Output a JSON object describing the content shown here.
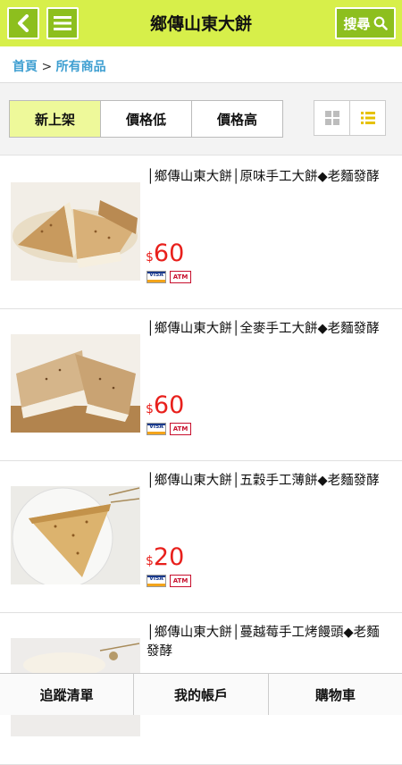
{
  "header": {
    "title": "鄉傳山東大餅",
    "search_label": "搜尋",
    "back_icon": "chevron-left-icon",
    "menu_icon": "hamburger-menu-icon",
    "accent_color": "#d7ef4a",
    "button_color": "#8dbf1e"
  },
  "breadcrumb": {
    "home": "首頁",
    "separator": ">",
    "current": "所有商品"
  },
  "sort": {
    "tabs": [
      "新上架",
      "價格低",
      "價格高"
    ],
    "active_index": 0
  },
  "view_toggle": {
    "grid_icon": "grid-view-icon",
    "list_icon": "list-view-icon",
    "active": "list"
  },
  "products": [
    {
      "name": "│鄉傳山東大餅│原味手工大餅◆老麵發酵",
      "currency": "$",
      "price": "60",
      "payments": [
        "VISA",
        "ATM"
      ]
    },
    {
      "name": "│鄉傳山東大餅│全麥手工大餅◆老麵發酵",
      "currency": "$",
      "price": "60",
      "payments": [
        "VISA",
        "ATM"
      ]
    },
    {
      "name": "│鄉傳山東大餅│五穀手工薄餅◆老麵發酵",
      "currency": "$",
      "price": "20",
      "payments": [
        "VISA",
        "ATM"
      ]
    },
    {
      "name": "│鄉傳山東大餅│蔓越莓手工烤饅頭◆老麵發酵",
      "currency": "",
      "price": "",
      "payments": []
    }
  ],
  "footer": {
    "tabs": [
      "追蹤清單",
      "我的帳戶",
      "購物車"
    ]
  }
}
